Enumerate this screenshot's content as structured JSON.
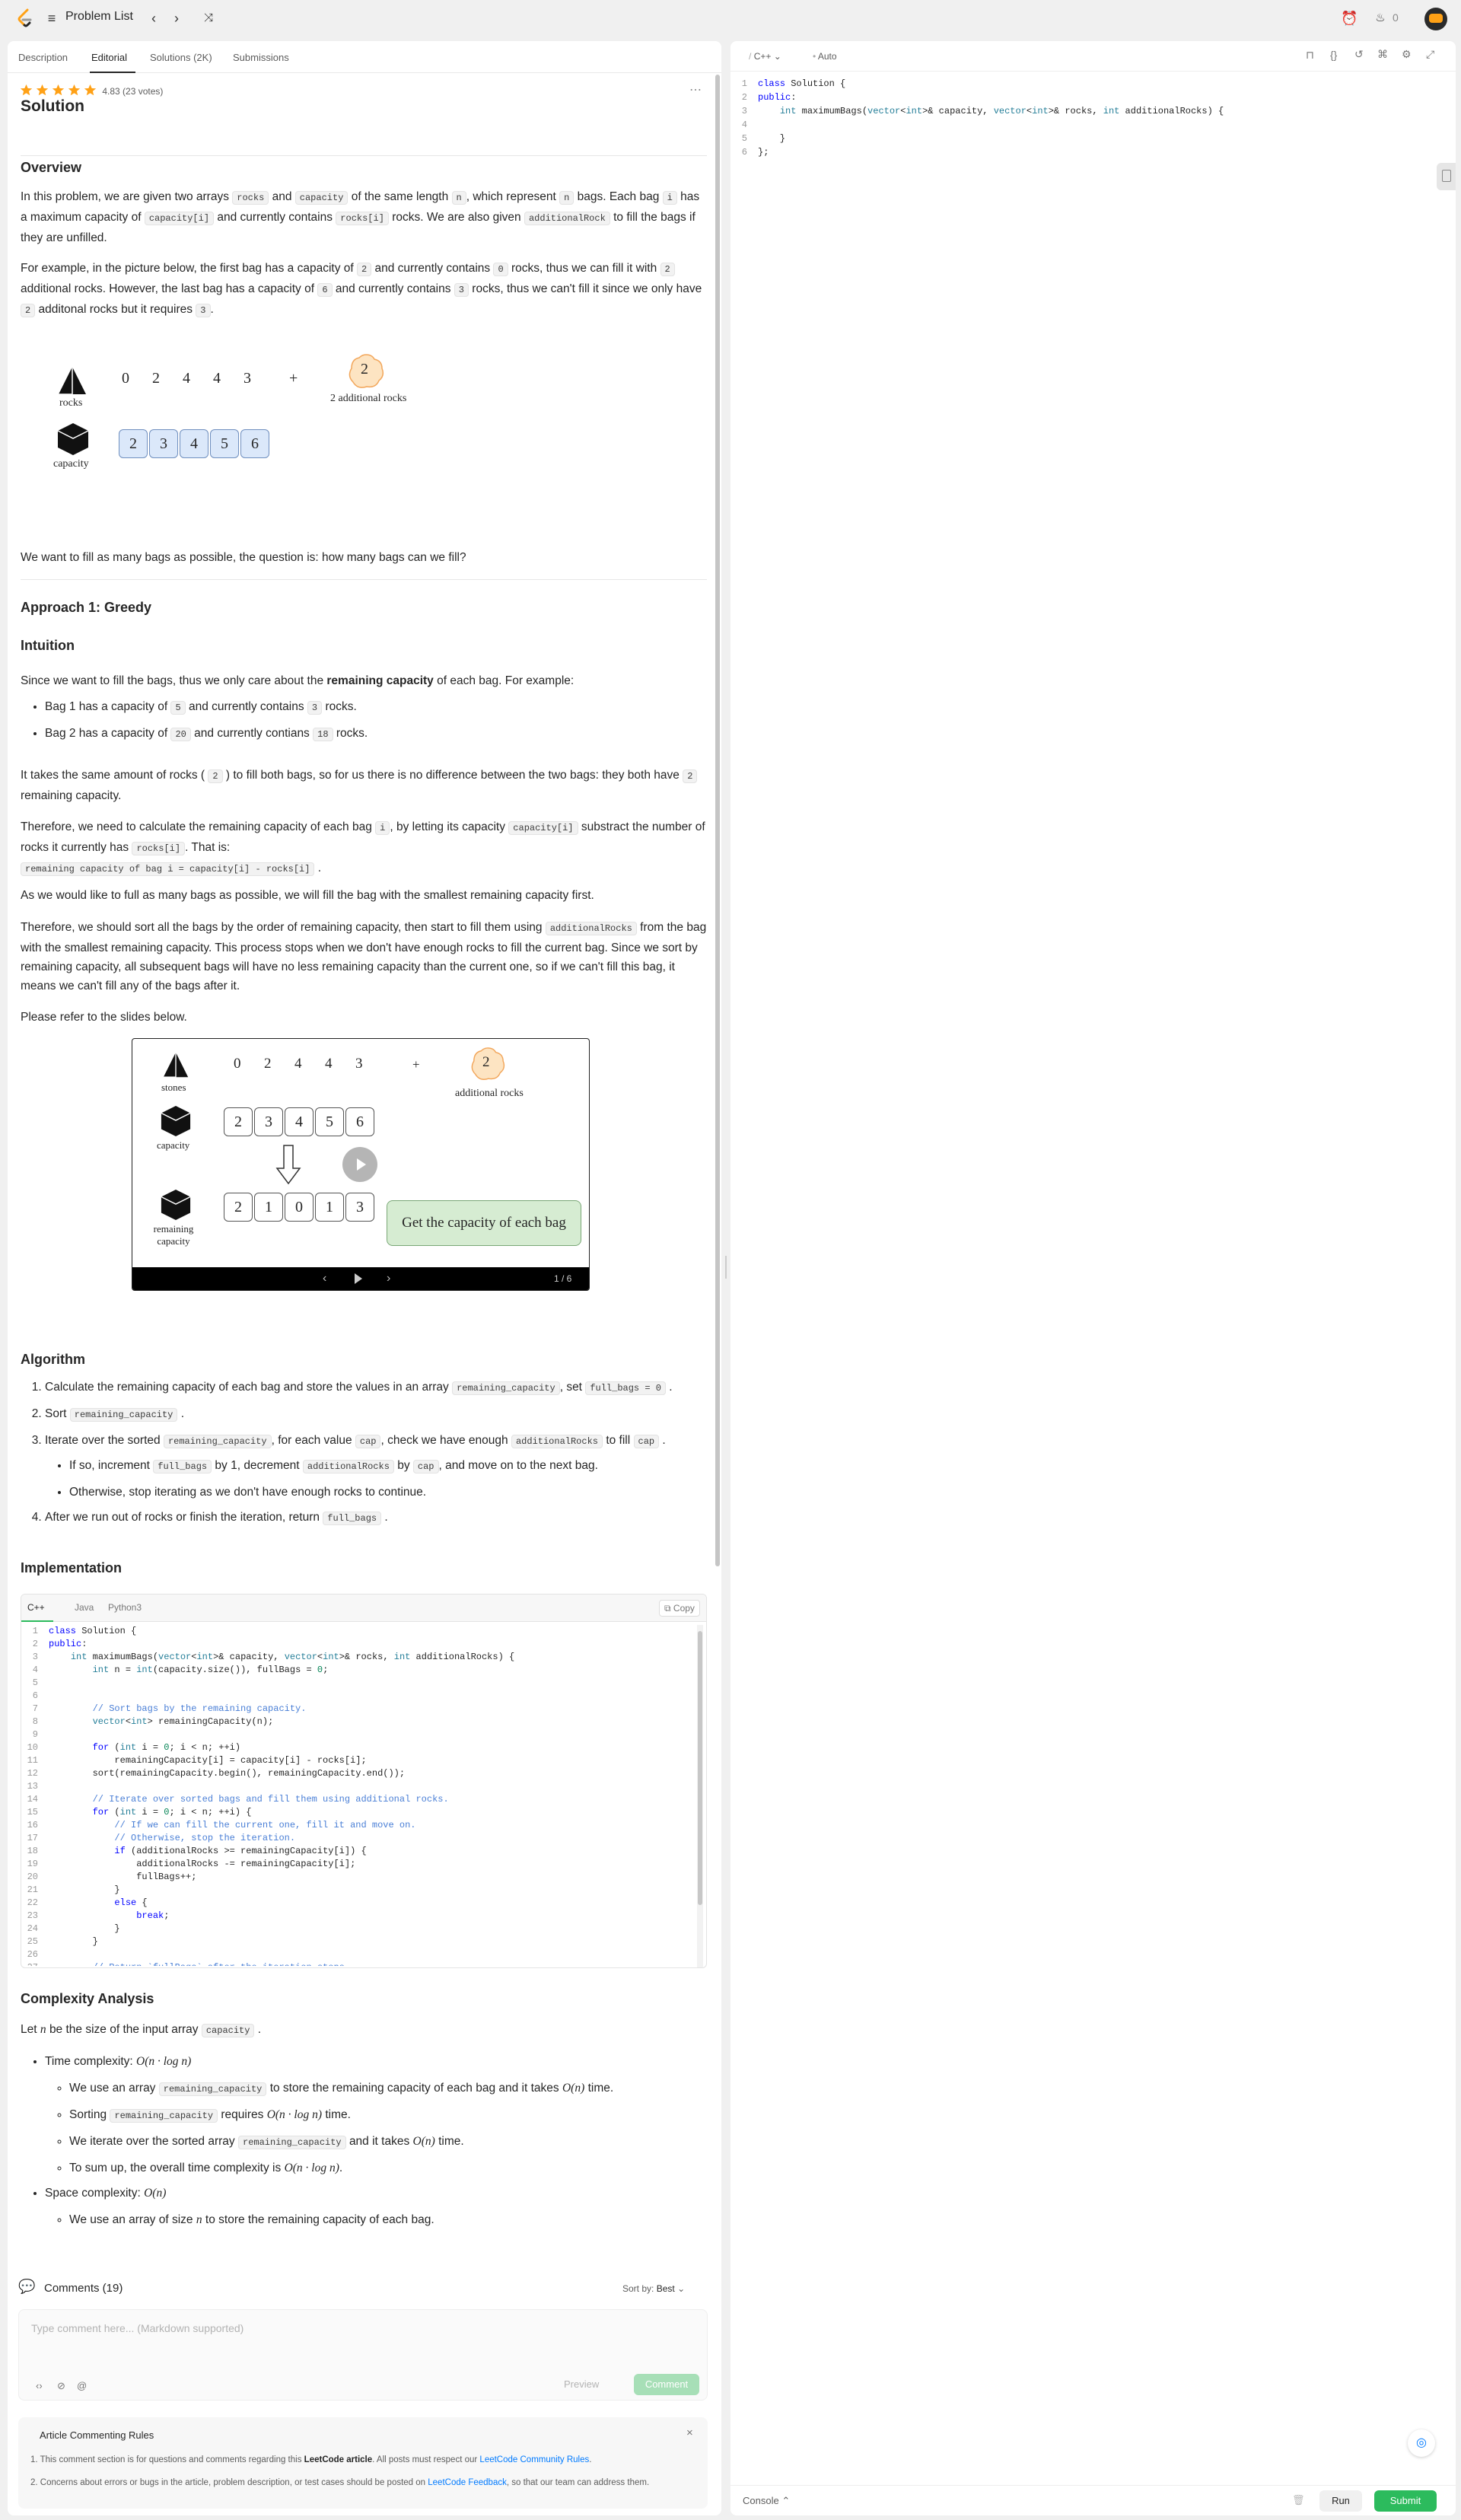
{
  "topbar": {
    "title": "Problem List",
    "streak_count": "0"
  },
  "tabs": [
    "Description",
    "Editorial",
    "Solutions (2K)",
    "Submissions"
  ],
  "rating": {
    "score": "4.83",
    "votes": "(23 votes)"
  },
  "solution_title": "Solution",
  "overview": {
    "heading": "Overview",
    "p1_a": "In this problem, we are given two arrays",
    "p1_b": "and",
    "p1_c": "of the same length",
    "p1_d": ", which represent",
    "p1_e": "bags. Each bag",
    "p1_f": "has a maximum capacity of",
    "p1_g": "and currently contains",
    "p1_h": "rocks. We are also given",
    "p1_i": "to fill the bags if they are unfilled.",
    "c_rocks": "rocks",
    "c_capacity": "capacity",
    "c_n": "n",
    "c_i": "i",
    "c_cap_i": "capacity[i]",
    "c_rocks_i": "rocks[i]",
    "c_add": "additionalRock",
    "p2_a": "For example, in the picture below, the first bag has a capacity of",
    "p2_b": "and currently contains",
    "p2_c": "rocks, thus we can fill it with",
    "p2_d": "additional rocks. However, the last bag has a capacity of",
    "p2_e": "and currently contains",
    "p2_f": "rocks, thus we can't fill it since we only have",
    "p2_g": "additonal rocks but it requires",
    "v2": "2",
    "v0": "0",
    "v6": "6",
    "v3": "3",
    "question": "We want to fill as many bags as possible, the question is: how many bags can we fill?"
  },
  "figure1": {
    "rocks_label": "rocks",
    "capacity_label": "capacity",
    "rocks": [
      "0",
      "2",
      "4",
      "4",
      "3"
    ],
    "capacity": [
      "2",
      "3",
      "4",
      "5",
      "6"
    ],
    "plus": "+",
    "additional_count": "2",
    "additional_label": "2 additional rocks"
  },
  "approach": {
    "heading": "Approach 1: Greedy",
    "intuition": "Intuition",
    "p1_a": "Since we want to fill the bags, thus we only care about the",
    "p1_b": "remaining capacity",
    "p1_c": "of each bag. For example:",
    "bag1_a": "Bag 1 has a capacity of",
    "bag1_b": "and currently contains",
    "bag1_c": "rocks.",
    "bag1_cap": "5",
    "bag1_rocks": "3",
    "bag2_a": "Bag 2 has a capacity of",
    "bag2_b": "and currently contians",
    "bag2_c": "rocks.",
    "bag2_cap": "20",
    "bag2_rocks": "18",
    "p2_a": "It takes the same amount of rocks (",
    "p2_v": "2",
    "p2_b": ") to fill both bags, so for us there is no difference between the two bags: they both have",
    "p2_c": "remaining capacity.",
    "p3_a": "Therefore, we need to calculate the remaining capacity of each bag",
    "p3_i": "i",
    "p3_b": ", by letting its capacity",
    "p3_cap": "capacity[i]",
    "p3_c": "substract the number of rocks it currently has",
    "p3_rocks": "rocks[i]",
    "p3_d": ". That is:",
    "p3_formula": "remaining capacity of bag i = capacity[i] - rocks[i]",
    "p4": "As we would like to full as many bags as possible, we will fill the bag with the smallest remaining capacity first.",
    "p5_a": "Therefore, we should sort all the bags by the order of remaining capacity, then start to fill them using",
    "p5_code": "additionalRocks",
    "p5_b": "from the bag with the smallest remaining capacity. This process stops when we don't have enough rocks to fill the current bag. Since we sort by remaining capacity, all subsequent bags will have no less remaining capacity than the current one, so if we can't fill this bag, it means we can't fill any of the bags after it.",
    "p6": "Please refer to the slides below."
  },
  "slide": {
    "stones_label": "stones",
    "capacity_label": "capacity",
    "remaining_label_1": "remaining",
    "remaining_label_2": "capacity",
    "stones": [
      "0",
      "2",
      "4",
      "4",
      "3"
    ],
    "capacity": [
      "2",
      "3",
      "4",
      "5",
      "6"
    ],
    "remaining": [
      "2",
      "1",
      "0",
      "1",
      "3"
    ],
    "plus": "+",
    "additional_count": "2",
    "additional_label": "additional rocks",
    "caption": "Get the capacity of each bag",
    "counter": "1 / 6"
  },
  "algorithm": {
    "heading": "Algorithm",
    "s1_a": "Calculate the remaining capacity of each bag and store the values in an array",
    "s1_code1": "remaining_capacity",
    "s1_b": ", set",
    "s1_code2": "full_bags = 0",
    "s1_c": ".",
    "s2_a": "Sort",
    "s2_code": "remaining_capacity",
    "s2_b": ".",
    "s3_a": "Iterate over the sorted",
    "s3_code1": "remaining_capacity",
    "s3_b": ", for each value",
    "s3_code2": "cap",
    "s3_c": ", check we have enough",
    "s3_code3": "additionalRocks",
    "s3_d": "to fill",
    "s3_code4": "cap",
    "s3_e": ".",
    "s3a_a": "If so, increment",
    "s3a_code1": "full_bags",
    "s3a_b": "by 1, decrement",
    "s3a_code2": "additionalRocks",
    "s3a_c": "by",
    "s3a_code3": "cap",
    "s3a_d": ", and move on to the next bag.",
    "s3b": "Otherwise, stop iterating as we don't have enough rocks to continue.",
    "s4_a": "After we run out of rocks or finish the iteration, return",
    "s4_code": "full_bags",
    "s4_b": "."
  },
  "implementation": {
    "heading": "Implementation",
    "tabs": [
      "C++",
      "Java",
      "Python3"
    ],
    "copy": "Copy",
    "lines": [
      "class Solution {",
      "public:",
      "    int maximumBags(vector<int>& capacity, vector<int>& rocks, int additionalRocks) {",
      "        int n = int(capacity.size()), fullBags = 0;",
      "",
      "",
      "        // Sort bags by the remaining capacity.",
      "        vector<int> remainingCapacity(n);",
      "",
      "        for (int i = 0; i < n; ++i)",
      "            remainingCapacity[i] = capacity[i] - rocks[i];",
      "        sort(remainingCapacity.begin(), remainingCapacity.end());",
      "",
      "        // Iterate over sorted bags and fill them using additional rocks.",
      "        for (int i = 0; i < n; ++i) {",
      "            // If we can fill the current one, fill it and move on.",
      "            // Otherwise, stop the iteration.",
      "            if (additionalRocks >= remainingCapacity[i]) {",
      "                additionalRocks -= remainingCapacity[i];",
      "                fullBags++;",
      "            }",
      "            else {",
      "                break;",
      "            }",
      "        }",
      "",
      "        // Return `fullBags` after the iteration stops."
    ]
  },
  "complexity": {
    "heading": "Complexity Analysis",
    "p1_a": "Let",
    "p1_n": "n",
    "p1_b": "be the size of the input array",
    "p1_code": "capacity",
    "p1_c": ".",
    "time_a": "Time complexity:",
    "time_v": "O(n · log n)",
    "t1_a": "We use an array",
    "t1_code": "remaining_capacity",
    "t1_b": "to store the remaining capacity of each bag and it takes",
    "t1_v": "O(n)",
    "t1_c": "time.",
    "t2_a": "Sorting",
    "t2_code": "remaining_capacity",
    "t2_b": "requires",
    "t2_v": "O(n · log n)",
    "t2_c": "time.",
    "t3_a": "We iterate over the sorted array",
    "t3_code": "remaining_capacity",
    "t3_b": "and it takes",
    "t3_v": "O(n)",
    "t3_c": "time.",
    "t4_a": "To sum up, the overall time complexity is",
    "t4_v": "O(n · log n)",
    "t4_b": ".",
    "space_a": "Space complexity:",
    "space_v": "O(n)",
    "s1_a": "We use an array of size",
    "s1_n": "n",
    "s1_b": "to store the remaining capacity of each bag."
  },
  "comments": {
    "title": "Comments (19)",
    "sort_label": "Sort by:",
    "sort_value": "Best",
    "placeholder": "Type comment here... (Markdown supported)",
    "preview": "Preview",
    "comment": "Comment",
    "rules_title": "Article Commenting Rules",
    "rule1_a": "1. This comment section is for questions and comments regarding this",
    "rule1_b": "LeetCode article",
    "rule1_c": ". All posts must respect our",
    "rule1_link": "LeetCode Community Rules",
    "rule1_d": ".",
    "rule2_a": "2. Concerns about errors or bugs in the article, problem description, or test cases should be posted on",
    "rule2_link": "LeetCode Feedback",
    "rule2_b": ", so that our team can address them."
  },
  "editor": {
    "language": "C++",
    "mode": "Auto",
    "lines": [
      "class Solution {",
      "public:",
      "    int maximumBags(vector<int>& capacity, vector<int>& rocks, int additionalRocks) {",
      "",
      "    }",
      "};"
    ]
  },
  "bottombar": {
    "console": "Console",
    "run": "Run",
    "submit": "Submit"
  },
  "colors": {
    "accent_green": "#2cbb5d",
    "link_blue": "#007aff",
    "star": "#ffa116"
  }
}
